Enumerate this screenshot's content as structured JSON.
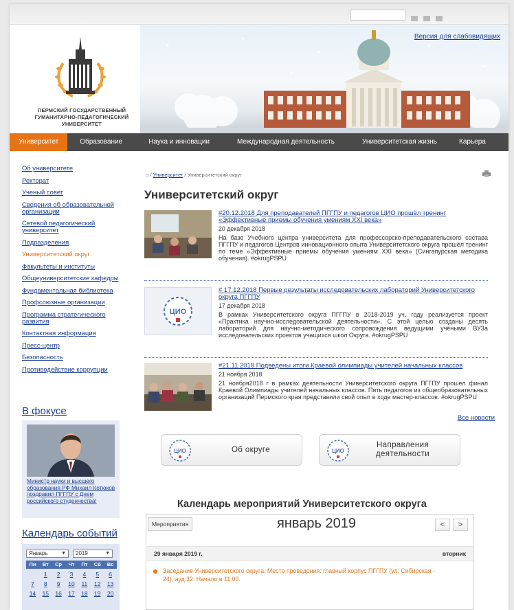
{
  "header": {
    "vision_link": "Версия для слабовидящих",
    "logo_text": [
      "ПЕРМСКИЙ ГОСУДАРСТВЕННЫЙ",
      "ГУМАНИТАРНО-ПЕДАГОГИЧЕСКИЙ",
      "УНИВЕРСИТЕТ"
    ]
  },
  "nav": [
    "Университет",
    "Образование",
    "Наука и инновации",
    "Международная деятельность",
    "Университетская жизнь",
    "Карьера"
  ],
  "sidebar": {
    "items": [
      "Об университете",
      "Ректорат",
      "Ученый совет",
      "Сведения об образовательной организации",
      "Сетевой педагогический университет",
      "Подразделения",
      "Университетский округ",
      "Факультеты и институты",
      "Общеуниверситетские кафедры",
      "Фундаментальная библиотека",
      "Профсоюзные организации",
      "Программа стратегического развития",
      "Контактная информация",
      "Пресс-центр",
      "Безопасность",
      "Противодействие коррупции"
    ],
    "current_index": 6,
    "focus_title": "В фокусе",
    "focus_caption": "Министр науки и высшего образования РФ Михаил Котюков поздравил ПГГПУ с Днем российского студенчества!",
    "calendar_title": "Календарь событий",
    "calendar_month": "Январь",
    "calendar_year": "2019",
    "calendar_days": [
      "Пн",
      "Вт",
      "Ср",
      "Чт",
      "Пт",
      "Сб",
      "Вс"
    ],
    "calendar_rows": [
      [
        "",
        "1",
        "2",
        "3",
        "4",
        "5",
        "6"
      ],
      [
        "7",
        "8",
        "9",
        "10",
        "11",
        "12",
        "13"
      ],
      [
        "14",
        "15",
        "16",
        "17",
        "18",
        "19",
        "20"
      ]
    ]
  },
  "breadcrumb": {
    "home": "⌂",
    "link": "Университет",
    "current": "Университетский округ"
  },
  "page_title": "Университетский округ",
  "news": [
    {
      "title": "#20.12.2018 Для преподавателей ПГГПУ и педагогов ЦИО прошёл тренинг «Эффективные приемы обучения умениям XXI века»",
      "date": "20 декабря 2018",
      "text": "На базе Учебного центра университета для профессорско-преподавательского состава ПГГПУ и педагогов Центров инновационного опыта Университетского округа прошёл тренинг по теме «Эффективные приемы обучения умениям XXI века» (Сингапурская методика обучения). #okrugPSPU"
    },
    {
      "title": "# 17.12.2018 Первые результаты исследовательских лабораторий Университетского округа ПГГПУ",
      "date": "17 декабря 2018",
      "text": "В рамках Университетского округа ПГГПУ в 2018-2019 уч. году реализуется проект «Практика научно-исследовательской деятельности». С этой целью созданы десять лабораторий для научно-методического сопровождения ведущими учёными ВУЗа исследовательских проектов учащихся школ Округа. #okrugPSPU"
    },
    {
      "title": "#21.11.2018 Подведены итоги Краевой олимпиады учителей начальных классов",
      "date": "21 ноября 2018",
      "text": "21 ноября2018 г в рамках деятельности Университетского округа ПГГПУ прошел финал Краевой Олимпиады учителей начальных классов. Пять педагогов из общеобразовательных организаций Пермского края представили свой опыт в ходе мастер-классов. #okrugPSPU"
    }
  ],
  "all_news": "Все новости",
  "buttons": {
    "about": "Об округе",
    "directions": "Направления деятельности",
    "badge": "ЦИО"
  },
  "events": {
    "title": "Календарь мероприятий Университетского округа",
    "tab": "Мероприятия",
    "month": "январь 2019",
    "prev": "<",
    "next": ">",
    "date": "29 января 2019 г.",
    "weekday": "вторник",
    "item": "Заседание Университетского округа. Место проведения: главный корпус ПГГПУ (ул. Сибирская - 24), ауд.32. Начало в 11.00."
  },
  "colors": {
    "accent": "#e67417",
    "link": "#1a3d8f",
    "nav_bg": "#4a4a4a"
  }
}
